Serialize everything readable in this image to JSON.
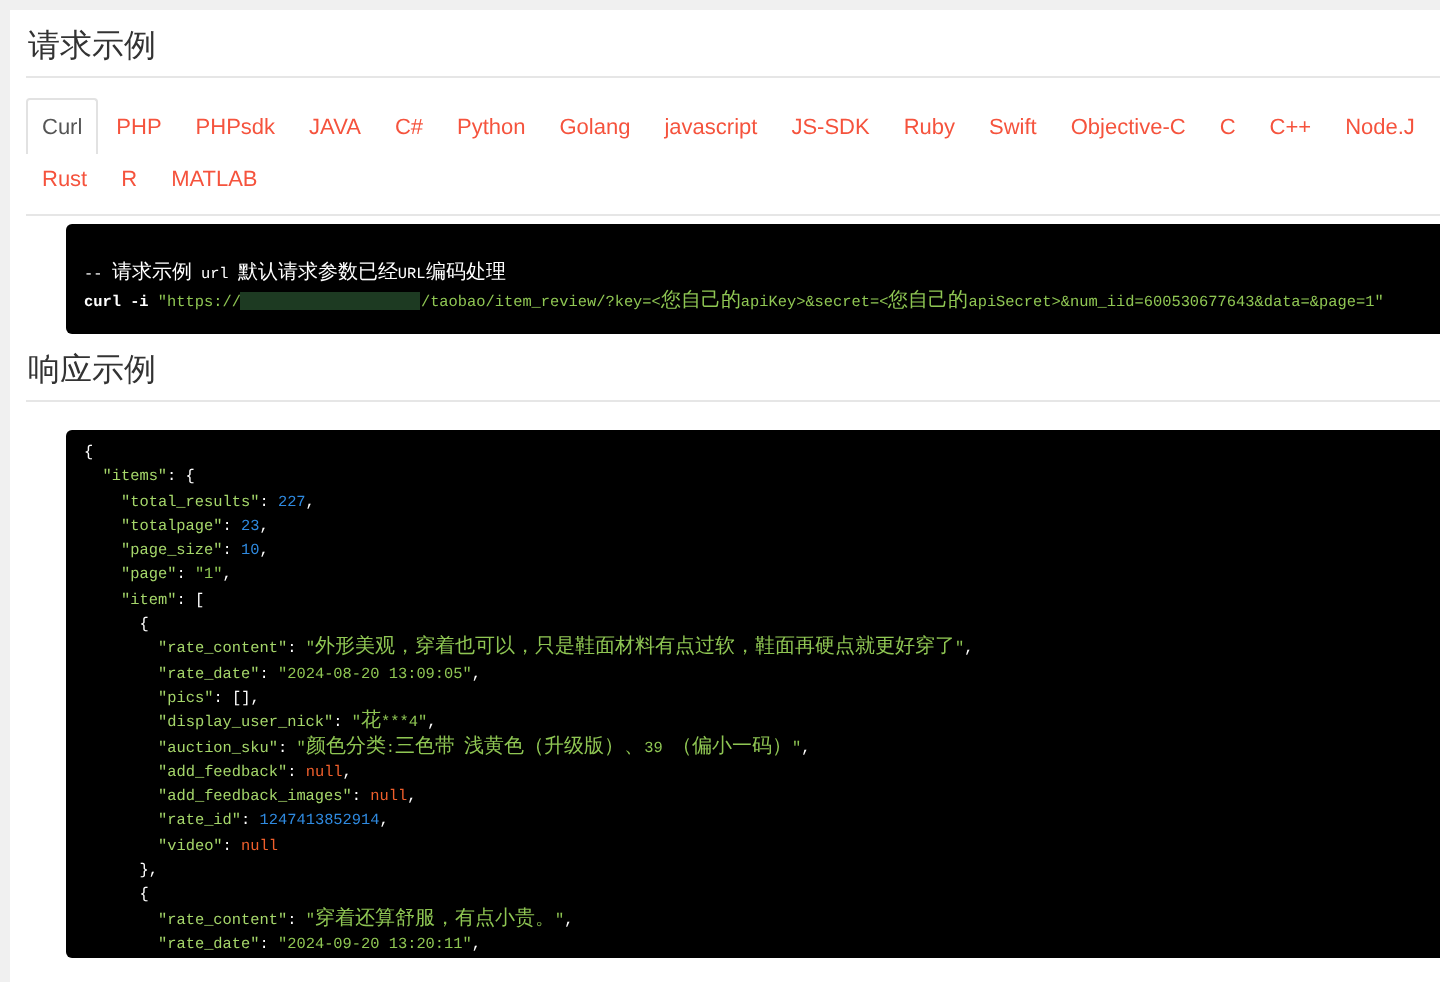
{
  "request_section": {
    "title": "请求示例",
    "tab_rows": [
      [
        {
          "label": "Curl",
          "selected": true
        },
        {
          "label": "PHP",
          "selected": false
        },
        {
          "label": "PHPsdk",
          "selected": false
        },
        {
          "label": "JAVA",
          "selected": false
        },
        {
          "label": "C#",
          "selected": false
        },
        {
          "label": "Python",
          "selected": false
        },
        {
          "label": "Golang",
          "selected": false
        },
        {
          "label": "javascript",
          "selected": false
        },
        {
          "label": "JS-SDK",
          "selected": false
        },
        {
          "label": "Ruby",
          "selected": false
        },
        {
          "label": "Swift",
          "selected": false
        },
        {
          "label": "Objective-C",
          "selected": false
        },
        {
          "label": "C",
          "selected": false
        },
        {
          "label": "C++",
          "selected": false
        },
        {
          "label": "Node.J",
          "selected": false
        }
      ],
      [
        {
          "label": "Rust",
          "selected": false
        },
        {
          "label": "R",
          "selected": false
        },
        {
          "label": "MATLAB",
          "selected": false
        }
      ]
    ],
    "code": {
      "comment": "-- 请求示例 url 默认请求参数已经URL编码处理",
      "command": "curl -i",
      "url_start": "\"https://",
      "url_end": "/taobao/item_review/?key=<您自己的apiKey>&secret=<您自己的apiSecret>&num_iid=600530677643&data=&page=1\""
    }
  },
  "response_section": {
    "title": "响应示例",
    "code_lines": [
      "{",
      "  \"items\": {",
      "    \"total_results\": 227,",
      "    \"totalpage\": 23,",
      "    \"page_size\": 10,",
      "    \"page\": \"1\",",
      "    \"item\": [",
      "      {",
      "        \"rate_content\": \"外形美观，穿着也可以，只是鞋面材料有点过软，鞋面再硬点就更好穿了\",",
      "        \"rate_date\": \"2024-08-20 13:09:05\",",
      "        \"pics\": [],",
      "        \"display_user_nick\": \"花***4\",",
      "        \"auction_sku\": \"颜色分类:三色带 浅黄色（升级版）、39 （偏小一码）\",",
      "        \"add_feedback\": null,",
      "        \"add_feedback_images\": null,",
      "        \"rate_id\": 1247413852914,",
      "        \"video\": null",
      "      },",
      "      {",
      "        \"rate_content\": \"穿着还算舒服，有点小贵。\",",
      "        \"rate_date\": \"2024-09-20 13:20:11\","
    ]
  }
}
